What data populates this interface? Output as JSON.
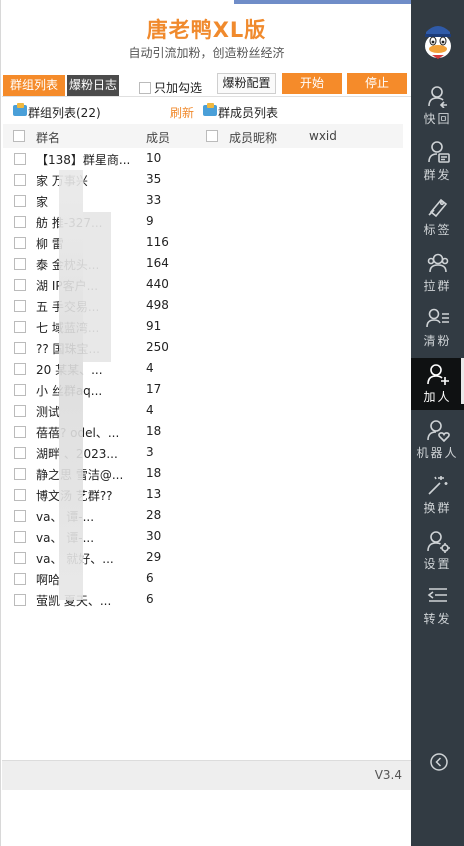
{
  "app": {
    "title": "唐老鸭XL版",
    "subtitle": "自动引流加粉，创造粉丝经济",
    "version": "V3.4"
  },
  "toolbar": {
    "tab_group_list": "群组列表",
    "tab_fans_log": "爆粉日志",
    "only_check_label": "只加勾选",
    "config_button": "爆粉配置",
    "start_button": "开始",
    "stop_button": "停止"
  },
  "sections": {
    "group_list_title": "群组列表(22)",
    "refresh_label": "刷新",
    "member_list_title": "群成员列表"
  },
  "columns": {
    "group_name": "群名",
    "member_count": "成员",
    "member_nickname": "成员昵称",
    "wxid": "wxid"
  },
  "groups": [
    {
      "name": "【138】群星商...",
      "count": "10"
    },
    {
      "name": "家   万事兴",
      "count": "35"
    },
    {
      "name": "家",
      "count": "33"
    },
    {
      "name": "舫      推-327...",
      "count": "9"
    },
    {
      "name": "柳        雷",
      "count": "116"
    },
    {
      "name": "泰      金枕头...",
      "count": "164"
    },
    {
      "name": "湖      IP客户...",
      "count": "440"
    },
    {
      "name": "五      手交易...",
      "count": "498"
    },
    {
      "name": "七      域蓝湾...",
      "count": "91"
    },
    {
      "name": "??      国珠宝...",
      "count": "250"
    },
    {
      "name": "20      某某、...",
      "count": "4"
    },
    {
      "name": "小      丝群aq...",
      "count": "17"
    },
    {
      "name": "测试",
      "count": "4"
    },
    {
      "name": "蓓蓓?  odel、...",
      "count": "18"
    },
    {
      "name": "湖畔      、2023...",
      "count": "3"
    },
    {
      "name": "静之思    雪洁@...",
      "count": "18"
    },
    {
      "name": "博文汤    艺群??",
      "count": "13"
    },
    {
      "name": "va、     谭-...",
      "count": "28"
    },
    {
      "name": "va、     谭-...",
      "count": "30"
    },
    {
      "name": "va、     就好、...",
      "count": "29"
    },
    {
      "name": "啊哈",
      "count": "6"
    },
    {
      "name": "萤凯    夏天、...",
      "count": "6"
    }
  ],
  "sidebar": {
    "items": [
      {
        "label": "快回",
        "icon": "person-reply-icon"
      },
      {
        "label": "群发",
        "icon": "person-message-icon"
      },
      {
        "label": "标签",
        "icon": "tag-icon"
      },
      {
        "label": "拉群",
        "icon": "group-people-icon"
      },
      {
        "label": "清粉",
        "icon": "person-list-icon"
      },
      {
        "label": "加人",
        "icon": "person-add-icon"
      },
      {
        "label": "机器人",
        "icon": "person-heart-icon"
      },
      {
        "label": "换群",
        "icon": "magic-wand-icon"
      },
      {
        "label": "设置",
        "icon": "person-gear-icon"
      },
      {
        "label": "转发",
        "icon": "forward-list-icon"
      }
    ],
    "active_item": "加人"
  },
  "colors": {
    "accent": "#f58b2a",
    "title": "#f08a2d",
    "sidebar_bg": "#323b43",
    "sidebar_active": "#0f1112"
  }
}
